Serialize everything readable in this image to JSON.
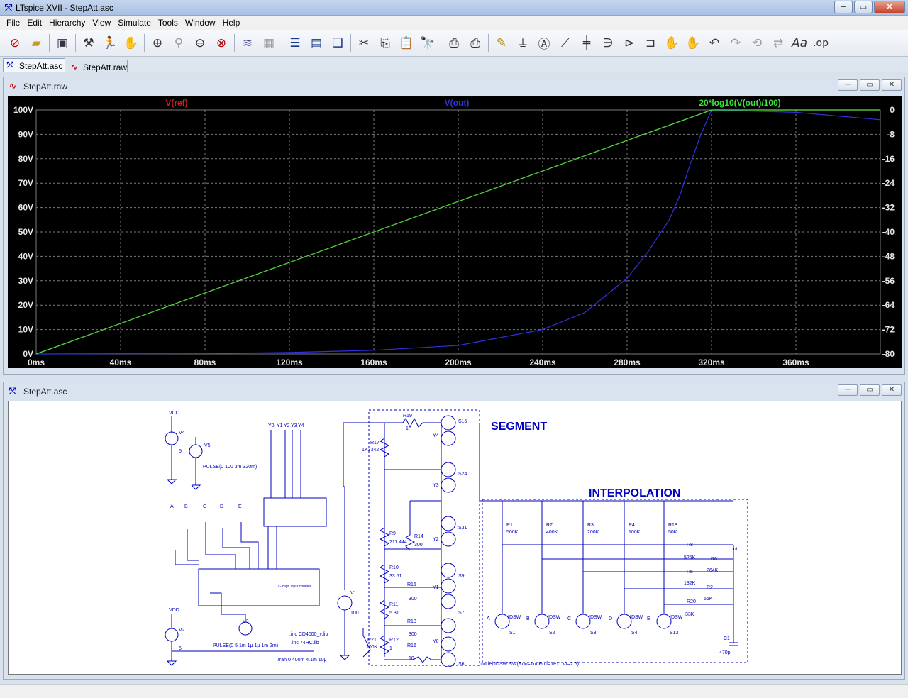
{
  "window": {
    "title": "LTspice XVII - StepAtt.asc",
    "app_icon": "ltspice-icon"
  },
  "menu": [
    "File",
    "Edit",
    "Hierarchy",
    "View",
    "Simulate",
    "Tools",
    "Window",
    "Help"
  ],
  "tabs": [
    {
      "label": "StepAtt.asc",
      "icon": "schematic-icon",
      "active": true
    },
    {
      "label": "StepAtt.raw",
      "icon": "waveform-icon",
      "active": false
    }
  ],
  "waveform_panel": {
    "title": "StepAtt.raw"
  },
  "schematic_panel": {
    "title": "StepAtt.asc"
  },
  "colors": {
    "ref": "#d02020",
    "out": "#3030e0",
    "db": "#40e040",
    "grid": "#7a7a7a",
    "axis_text": "#e8e8e8",
    "schem_wire": "#0000c0",
    "schem_label": "#0000c0"
  },
  "chart_data": {
    "type": "line",
    "x_ticks": [
      "0ms",
      "40ms",
      "80ms",
      "120ms",
      "160ms",
      "200ms",
      "240ms",
      "280ms",
      "320ms",
      "360ms"
    ],
    "x_tick_values": [
      0,
      40,
      80,
      120,
      160,
      200,
      240,
      280,
      320,
      360
    ],
    "xlim": [
      0,
      400
    ],
    "y_left_ticks": [
      "100V",
      "90V",
      "80V",
      "70V",
      "60V",
      "50V",
      "40V",
      "30V",
      "20V",
      "10V",
      "0V"
    ],
    "y_left_values": [
      100,
      90,
      80,
      70,
      60,
      50,
      40,
      30,
      20,
      10,
      0
    ],
    "ylim_left": [
      0,
      100
    ],
    "y_right_ticks": [
      "0",
      "-8",
      "-16",
      "-24",
      "-32",
      "-40",
      "-48",
      "-56",
      "-64",
      "-72",
      "-80"
    ],
    "y_right_values": [
      0,
      -8,
      -16,
      -24,
      -32,
      -40,
      -48,
      -56,
      -64,
      -72,
      -80
    ],
    "ylim_right": [
      -80,
      0
    ],
    "grid": true,
    "series": [
      {
        "name": "V(ref)",
        "axis": "left",
        "color": "#d02020",
        "x": [
          0,
          320,
          320,
          400
        ],
        "y": [
          0,
          100,
          100,
          100
        ]
      },
      {
        "name": "V(out)",
        "axis": "left",
        "color": "#3030e0",
        "x": [
          0,
          80,
          120,
          160,
          200,
          240,
          260,
          280,
          290,
          300,
          305,
          310,
          315,
          320,
          360,
          400
        ],
        "y": [
          0,
          0.2,
          0.6,
          1.5,
          3.5,
          10,
          17,
          31,
          42,
          55,
          65,
          78,
          90,
          100,
          99,
          96
        ]
      },
      {
        "name": "20*log10(V(out)/100)",
        "axis": "right",
        "color": "#40e040",
        "x": [
          0,
          320,
          320,
          400
        ],
        "y": [
          -80,
          0,
          0,
          0
        ]
      }
    ]
  },
  "schematic": {
    "labels": {
      "segment": "SEGMENT",
      "interpolation": "INTERPOLATION",
      "vcc": "VCC",
      "vdd": "VDD",
      "v4": "V4",
      "v5": "V5",
      "v2": "V2",
      "v3": "V3",
      "v1": "V1",
      "v4_val": "5",
      "v2_val": "5",
      "v1_val": "100",
      "v5_pulse": "PULSE(0 100 3m 320m)",
      "v3_pulse": "PULSE(0 5 1m 1μ 1μ 1m 2m)",
      "inc1": ".inc CD4000_v.lib",
      "inc2": ".inc 74HC.lib",
      "tran": ".tran 0 400m 4.1m 10μ",
      "model": ".model IDSW SW(Ron=1m Roff=1e11 Vt=2.5)",
      "out": "out",
      "ic_text": "<- High input counter",
      "r19": "R19",
      "r19v": "1",
      "r17": "R17",
      "r17v": "1K3342",
      "r9": "R9",
      "r9v": "211.444",
      "r14": "R14",
      "r14v": "300",
      "r10": "R10",
      "r10v": "33.51",
      "r15": "R15",
      "r15v": "300",
      "r11": "R11",
      "r11v": "5.31",
      "r13": "R13",
      "r13v": "300",
      "r12": "R12",
      "r12v": "1",
      "r16": "R16",
      "r16v": "10",
      "r21": "R21",
      "r21v": "100K",
      "r1": "R1",
      "r1v": "500K",
      "r7": "R7",
      "r7v": "400K",
      "r3": "R3",
      "r3v": "200K",
      "r4": "R4",
      "r4v": "100K",
      "r18": "R18",
      "r18v": "50K",
      "r8": "R8",
      "r8v": "525K",
      "r6": "R6",
      "r6v": "264K",
      "r5": "R5",
      "r5v": "132K",
      "r2": "R2",
      "r2v": "66K",
      "r20": "R20",
      "r20v": "33K",
      "c1": "C1",
      "c1v": "470p",
      "idsw": "IDSW",
      "s15": "S15",
      "s24": "S24",
      "s31": "S31",
      "s9": "S9",
      "s7": "S7",
      "s6": "S6",
      "s1": "S1",
      "s2": "S2",
      "s3": "S3",
      "s4": "S4",
      "s13": "S13",
      "y4": "Y4",
      "y3": "Y3",
      "y2": "Y2",
      "y1": "Y1",
      "y0": "Y0",
      "a": "A",
      "b": "B",
      "c": "C",
      "d": "D",
      "e": "E"
    }
  }
}
